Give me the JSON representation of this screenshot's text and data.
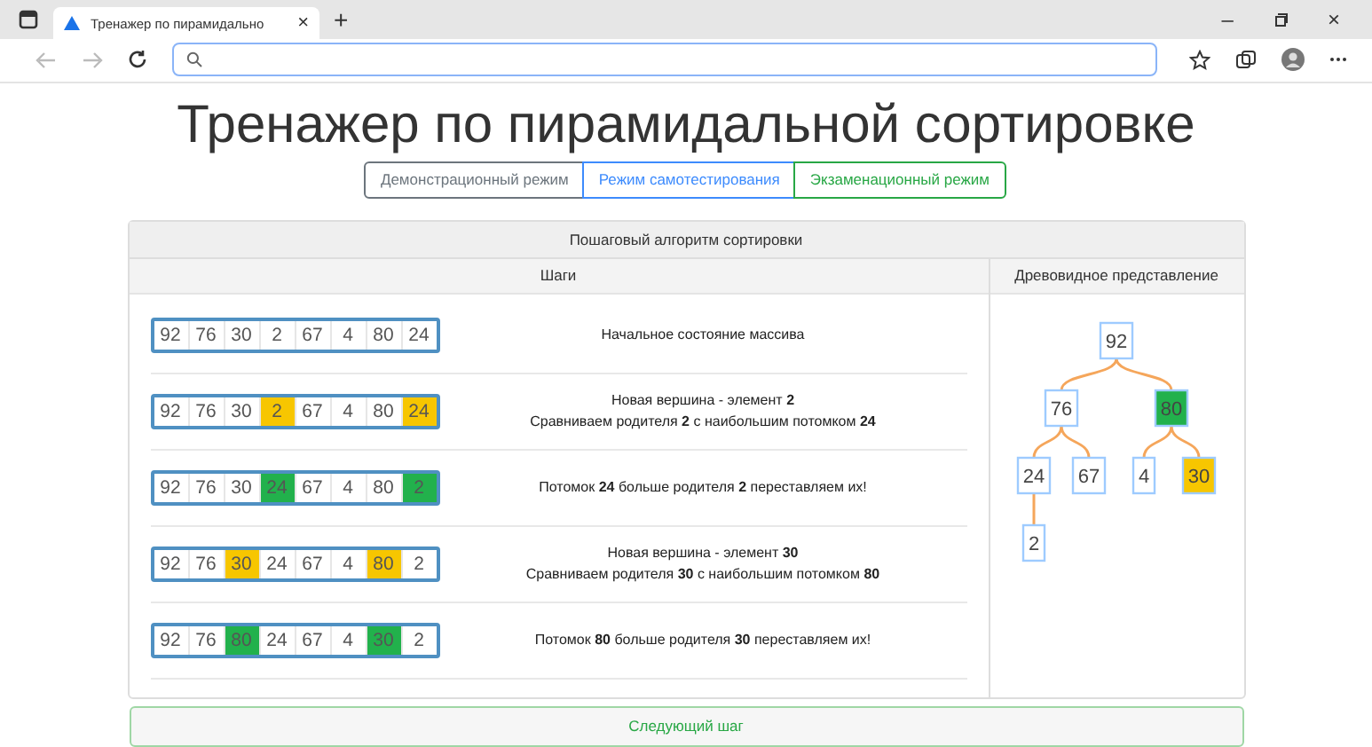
{
  "browser": {
    "tab_title": "Тренажер по пирамидально",
    "tab_close": "×",
    "new_tab": "+",
    "minimize": "–",
    "close": "×"
  },
  "title": "Тренажер по пирамидальной сортировке",
  "modes": [
    {
      "label": "Демонстрационный режим",
      "color": "#6c757d"
    },
    {
      "label": "Режим самотестирования",
      "color": "#3d8bfd"
    },
    {
      "label": "Экзаменационный режим",
      "color": "#28a745"
    }
  ],
  "card": {
    "header": "Пошаговый алгоритм сортировки",
    "steps_heading": "Шаги",
    "tree_heading": "Древовидное представление",
    "steps": [
      {
        "cells": [
          {
            "value": "92",
            "kind": "plain"
          },
          {
            "value": "76",
            "kind": "plain"
          },
          {
            "value": "30",
            "kind": "plain"
          },
          {
            "value": "2",
            "kind": "plain"
          },
          {
            "value": "67",
            "kind": "plain"
          },
          {
            "value": "4",
            "kind": "plain"
          },
          {
            "value": "80",
            "kind": "plain"
          },
          {
            "value": "24",
            "kind": "plain"
          }
        ],
        "lines": [
          "Начальное состояние массива"
        ]
      },
      {
        "cells": [
          {
            "value": "92",
            "kind": "plain"
          },
          {
            "value": "76",
            "kind": "plain"
          },
          {
            "value": "30",
            "kind": "plain"
          },
          {
            "value": "2",
            "kind": "compare"
          },
          {
            "value": "67",
            "kind": "plain"
          },
          {
            "value": "4",
            "kind": "plain"
          },
          {
            "value": "80",
            "kind": "plain"
          },
          {
            "value": "24",
            "kind": "compare"
          }
        ],
        "lines": [
          "Новая вершина - элемент **2**",
          "Сравниваем родителя **2** с наибольшим потомком **24**"
        ]
      },
      {
        "cells": [
          {
            "value": "92",
            "kind": "plain"
          },
          {
            "value": "76",
            "kind": "plain"
          },
          {
            "value": "30",
            "kind": "plain"
          },
          {
            "value": "24",
            "kind": "swap"
          },
          {
            "value": "67",
            "kind": "plain"
          },
          {
            "value": "4",
            "kind": "plain"
          },
          {
            "value": "80",
            "kind": "plain"
          },
          {
            "value": "2",
            "kind": "swap"
          }
        ],
        "lines": [
          "Потомок **24** больше родителя **2** переставляем их!"
        ]
      },
      {
        "cells": [
          {
            "value": "92",
            "kind": "plain"
          },
          {
            "value": "76",
            "kind": "plain"
          },
          {
            "value": "30",
            "kind": "compare"
          },
          {
            "value": "24",
            "kind": "plain"
          },
          {
            "value": "67",
            "kind": "plain"
          },
          {
            "value": "4",
            "kind": "plain"
          },
          {
            "value": "80",
            "kind": "compare"
          },
          {
            "value": "2",
            "kind": "plain"
          }
        ],
        "lines": [
          "Новая вершина - элемент **30**",
          "Сравниваем родителя **30** с наибольшим потомком **80**"
        ]
      },
      {
        "cells": [
          {
            "value": "92",
            "kind": "plain"
          },
          {
            "value": "76",
            "kind": "plain"
          },
          {
            "value": "80",
            "kind": "swap"
          },
          {
            "value": "24",
            "kind": "plain"
          },
          {
            "value": "67",
            "kind": "plain"
          },
          {
            "value": "4",
            "kind": "plain"
          },
          {
            "value": "30",
            "kind": "swap"
          },
          {
            "value": "2",
            "kind": "plain"
          }
        ],
        "lines": [
          "Потомок **80** больше родителя **30** переставляем их!"
        ]
      }
    ],
    "tree": {
      "value": "92",
      "kind": "plain",
      "children": [
        {
          "value": "76",
          "kind": "plain",
          "children": [
            {
              "value": "24",
              "kind": "plain",
              "children": [
                {
                  "value": "2",
                  "kind": "plain"
                }
              ]
            },
            {
              "value": "67",
              "kind": "plain"
            }
          ]
        },
        {
          "value": "80",
          "kind": "swap",
          "children": [
            {
              "value": "4",
              "kind": "plain"
            },
            {
              "value": "30",
              "kind": "compare"
            }
          ]
        }
      ]
    },
    "next_button": "Следующий шаг"
  }
}
